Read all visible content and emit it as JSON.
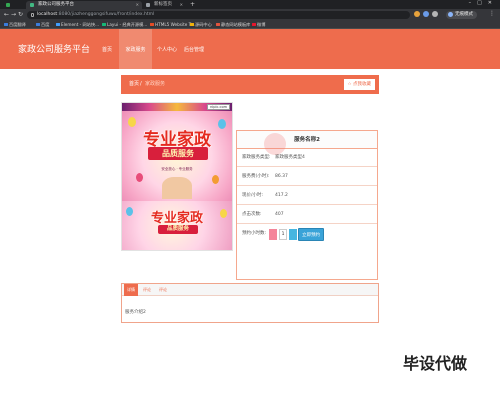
{
  "browser": {
    "tabs": [
      {
        "label": ""
      },
      {
        "label": "家政公司服务平台"
      },
      {
        "label": "新标签页"
      }
    ],
    "url_host": "localhost",
    "url_path": ":8080/jiazhenggongsifuwu/front/index.html",
    "profile_label": "无痕模式",
    "bookmarks": [
      {
        "label": "百度翻译",
        "color": "#3b7ddd"
      },
      {
        "label": "百度",
        "color": "#3b7ddd"
      },
      {
        "label": "Element - 网站快...",
        "color": "#409eff"
      },
      {
        "label": "Layui - 经典开源模...",
        "color": "#16b777"
      },
      {
        "label": "HTML5 Website T...",
        "color": "#e44d26"
      },
      {
        "label": "源码中心",
        "color": "#f1b20b"
      },
      {
        "label": "静态网站模板库",
        "color": "#e0543e"
      },
      {
        "label": "微博",
        "color": "#e6162d"
      }
    ]
  },
  "header": {
    "site_title": "家政公司服务平台",
    "menu": [
      {
        "label": "首页",
        "active": false
      },
      {
        "label": "家政服务",
        "active": true
      },
      {
        "label": "个人中心",
        "active": false
      },
      {
        "label": "后台管理",
        "active": false
      }
    ]
  },
  "breadcrumb": {
    "home": "首页",
    "sep": "/",
    "current": "家政服务",
    "collect_button": "☆ 点我收藏"
  },
  "gallery": {
    "url_tag": "nipic.com",
    "headline": "专业家政",
    "ribbon": "品质服务",
    "subline": "安全放心 · 专业服务",
    "headline2": "专业家政",
    "ribbon2": "品质服务"
  },
  "detail": {
    "title": "服务名称2",
    "rows": [
      {
        "label": "家政服务类型:",
        "value": "家政服务类型4"
      },
      {
        "label": "服务费(小时):",
        "value": "86.37"
      },
      {
        "label": "现价/小时:",
        "value": "417.2"
      },
      {
        "label": "点击次数:",
        "value": "407"
      }
    ],
    "qty_label": "预约小时数:",
    "qty_value": "1",
    "book_button": "立即预约"
  },
  "tabs": {
    "items": [
      {
        "label": "详情",
        "active": true
      },
      {
        "label": "评论",
        "active": false
      },
      {
        "label": "评论",
        "active": false
      }
    ],
    "content": "服务介绍2"
  },
  "watermark": "毕设代做",
  "colors": {
    "brand": "#ee6c4d",
    "book": "#3aa3d8"
  }
}
